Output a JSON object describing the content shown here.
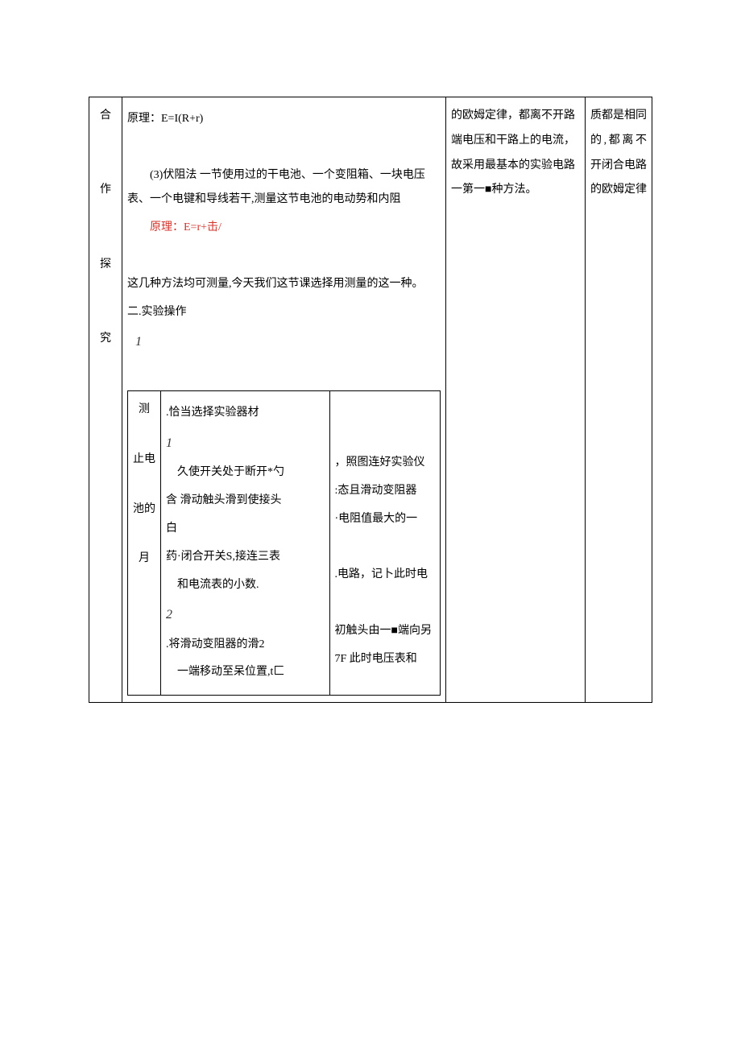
{
  "leftLabel": "合\n\n\n作\n\n\n探\n\n\n究",
  "mainCol": {
    "principle1": "原理：E=I(R+r)",
    "p3": "(3)伏阻法 一节使用过的干电池、一个变阻箱、一块电压表、一个电键和导线若干,测量这节电池的电动势和内阻",
    "principle3": "原理：E=r+击/",
    "summary": "这几种方法均可测量,今天我们这节课选择用测量的这一种。",
    "secTitle": "二.实验操作",
    "innerNum1": "1",
    "innerLeftLabel": "测\n\n止电\n\n池的\n\n月",
    "innerLeft": {
      "l1": ".恰当选择实验器材",
      "num1": "1",
      "l2": "　久使开关处于断开*勺",
      "l3": "含  滑动触头滑到使接头",
      "l4": "白",
      "l5": "药·闭合开关S,接连三表",
      "l6": "　和电流表的小数.",
      "num2": "2",
      "l7": ".将滑动变阻器的滑2",
      "l8": "　一端移动至呆位置,t匚"
    },
    "innerRight": {
      "r1": "，照图连好实验仪",
      "r2": ":态且滑动变阻器",
      "r3": "·电阻值最大的一",
      "r4": ".电路，记卜此时电",
      "r5": "初触头由一■端向另",
      "r6": "7F 此时电压表和"
    }
  },
  "col3": {
    "t1": "的欧姆定律，都离不开路端电压和干路上的电流，故采用最基本的实验电路一第一■种方法。"
  },
  "col4": {
    "t1": "质都是相同的,都离不开闭合电路的欧姆定律"
  }
}
